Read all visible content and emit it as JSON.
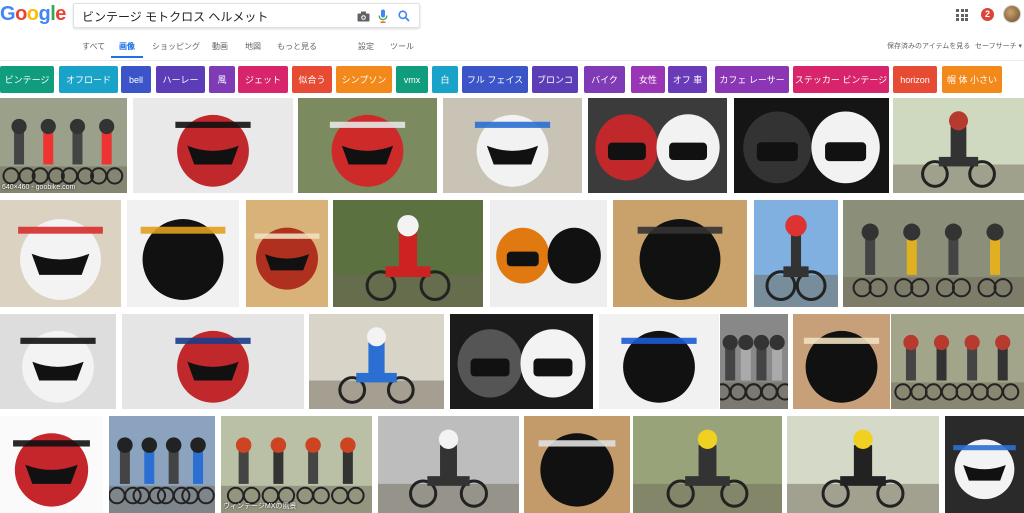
{
  "logo": {
    "letters": [
      "G",
      "o",
      "o",
      "g",
      "l",
      "e"
    ],
    "colors": [
      "#4285f4",
      "#ea4335",
      "#fbbc05",
      "#4285f4",
      "#34a853",
      "#ea4335"
    ]
  },
  "search": {
    "query": "ビンテージ モトクロス ヘルメット"
  },
  "header": {
    "notification_count": "2"
  },
  "tabs": {
    "all": "すべて",
    "images": "画像",
    "shopping": "ショッピング",
    "videos": "動画",
    "maps": "地図",
    "more": "もっと見る",
    "settings": "設定",
    "tools": "ツール",
    "saved": "保存済みのアイテムを見る",
    "safesearch": "セーフサーチ ▾"
  },
  "chips": [
    {
      "label": "ビンテージ",
      "color": "#0f9d7e"
    },
    {
      "label": "オフロード",
      "color": "#1aa3c8"
    },
    {
      "label": "bell",
      "color": "#3b55c8"
    },
    {
      "label": "ハーレー",
      "color": "#5c3db8"
    },
    {
      "label": "風",
      "color": "#7e3bb5"
    },
    {
      "label": "ジェット",
      "color": "#d7246a"
    },
    {
      "label": "似合う",
      "color": "#e84b33"
    },
    {
      "label": "シンプソン",
      "color": "#f4891b"
    },
    {
      "label": "vmx",
      "color": "#0f9d7e"
    },
    {
      "label": "白",
      "color": "#1aa3c8"
    },
    {
      "label": "フル フェイス",
      "color": "#3b55c8"
    },
    {
      "label": "ブロンコ",
      "color": "#5c3db8"
    },
    {
      "label": "バイク",
      "color": "#7e3bb5"
    },
    {
      "label": "女性",
      "color": "#9a36b5"
    },
    {
      "label": "オフ 車",
      "color": "#6a3bb8"
    },
    {
      "label": "カフェ レーサー",
      "color": "#8b36b5"
    },
    {
      "label": "ステッカー ビンテージ",
      "color": "#d7246a"
    },
    {
      "label": "horizon",
      "color": "#e84b33"
    },
    {
      "label": "帽 体 小さい",
      "color": "#f4891b"
    }
  ],
  "images": [
    {
      "kind": "riders",
      "bg": "#9aa08a",
      "fg": "#333",
      "accent": "#e33",
      "caption": "640×460 - goobike.com"
    },
    {
      "kind": "helmet",
      "bg": "#e9e9e9",
      "fg": "#c0282c",
      "accent": "#111",
      "caption": ""
    },
    {
      "kind": "helmet",
      "bg": "#7c8a5f",
      "fg": "#cf2a2a",
      "accent": "#e6e6e6",
      "caption": ""
    },
    {
      "kind": "helmet",
      "bg": "#c9c3b6",
      "fg": "#f2f2f2",
      "accent": "#2a6fd1",
      "caption": ""
    },
    {
      "kind": "helmets",
      "bg": "#3b3b3b",
      "fg": "#f2f2f2",
      "accent": "#c0282c",
      "caption": ""
    },
    {
      "kind": "helmets",
      "bg": "#151515",
      "fg": "#f2f2f2",
      "accent": "#333",
      "caption": ""
    },
    {
      "kind": "rider",
      "bg": "#cfd9c0",
      "fg": "#b63a2e",
      "accent": "#333",
      "caption": ""
    },
    {
      "kind": "helmet",
      "bg": "#dcd2c2",
      "fg": "#f3f3f3",
      "accent": "#d62e2e",
      "caption": ""
    },
    {
      "kind": "helmet",
      "bg": "#f1f1f1",
      "fg": "#111",
      "accent": "#e0a020",
      "caption": ""
    },
    {
      "kind": "helmet",
      "bg": "#d9b27a",
      "fg": "#b0301f",
      "accent": "#f0e0c0",
      "caption": ""
    },
    {
      "kind": "rider",
      "bg": "#5c7140",
      "fg": "#f3f3f3",
      "accent": "#c22",
      "caption": ""
    },
    {
      "kind": "helmets",
      "bg": "#eeeeee",
      "fg": "#111",
      "accent": "#e07a10",
      "caption": ""
    },
    {
      "kind": "helmet",
      "bg": "#c8a26a",
      "fg": "#111",
      "accent": "#333",
      "caption": ""
    },
    {
      "kind": "rider",
      "bg": "#7fb0e0",
      "fg": "#d33",
      "accent": "#333",
      "caption": ""
    },
    {
      "kind": "riders",
      "bg": "#8b8f79",
      "fg": "#333",
      "accent": "#e0b020",
      "caption": ""
    },
    {
      "kind": "helmet",
      "bg": "#dddddd",
      "fg": "#f3f3f3",
      "accent": "#111",
      "caption": ""
    },
    {
      "kind": "helmet",
      "bg": "#e5e5e5",
      "fg": "#c0282c",
      "accent": "#1a3c8a",
      "caption": ""
    },
    {
      "kind": "rider",
      "bg": "#d9d4c8",
      "fg": "#f3f3f3",
      "accent": "#2a6fd1",
      "caption": ""
    },
    {
      "kind": "helmets",
      "bg": "#1b1b1b",
      "fg": "#f3f3f3",
      "accent": "#555",
      "caption": ""
    },
    {
      "kind": "helmet",
      "bg": "#f1f1f1",
      "fg": "#111",
      "accent": "#1a5bd1",
      "caption": ""
    },
    {
      "kind": "riders",
      "bg": "#888",
      "fg": "#333",
      "accent": "#aaa",
      "caption": ""
    },
    {
      "kind": "helmet",
      "bg": "#c7a07a",
      "fg": "#111",
      "accent": "#f0e0c0",
      "caption": ""
    },
    {
      "kind": "riders",
      "bg": "#a3a58a",
      "fg": "#b63a2e",
      "accent": "#333",
      "caption": ""
    },
    {
      "kind": "helmet",
      "bg": "#fafafa",
      "fg": "#c4262b",
      "accent": "#111",
      "caption": ""
    },
    {
      "kind": "riders",
      "bg": "#8ca3c0",
      "fg": "#222",
      "accent": "#2a6fd1",
      "caption": ""
    },
    {
      "kind": "riders",
      "bg": "#b9c0a6",
      "fg": "#c42",
      "accent": "#333",
      "caption": "ヴィンテージMXの風景"
    },
    {
      "kind": "rider",
      "bg": "#bdbdbd",
      "fg": "#f3f3f3",
      "accent": "#333",
      "caption": ""
    },
    {
      "kind": "helmet",
      "bg": "#c39a69",
      "fg": "#111",
      "accent": "#e0e0e0",
      "caption": ""
    },
    {
      "kind": "rider",
      "bg": "#98a37a",
      "fg": "#f0d020",
      "accent": "#333",
      "caption": ""
    },
    {
      "kind": "rider",
      "bg": "#d4d9c8",
      "fg": "#f0d020",
      "accent": "#222",
      "caption": ""
    },
    {
      "kind": "helmet",
      "bg": "#2a2a2a",
      "fg": "#f3f3f3",
      "accent": "#2a6fd1",
      "caption": ""
    }
  ]
}
